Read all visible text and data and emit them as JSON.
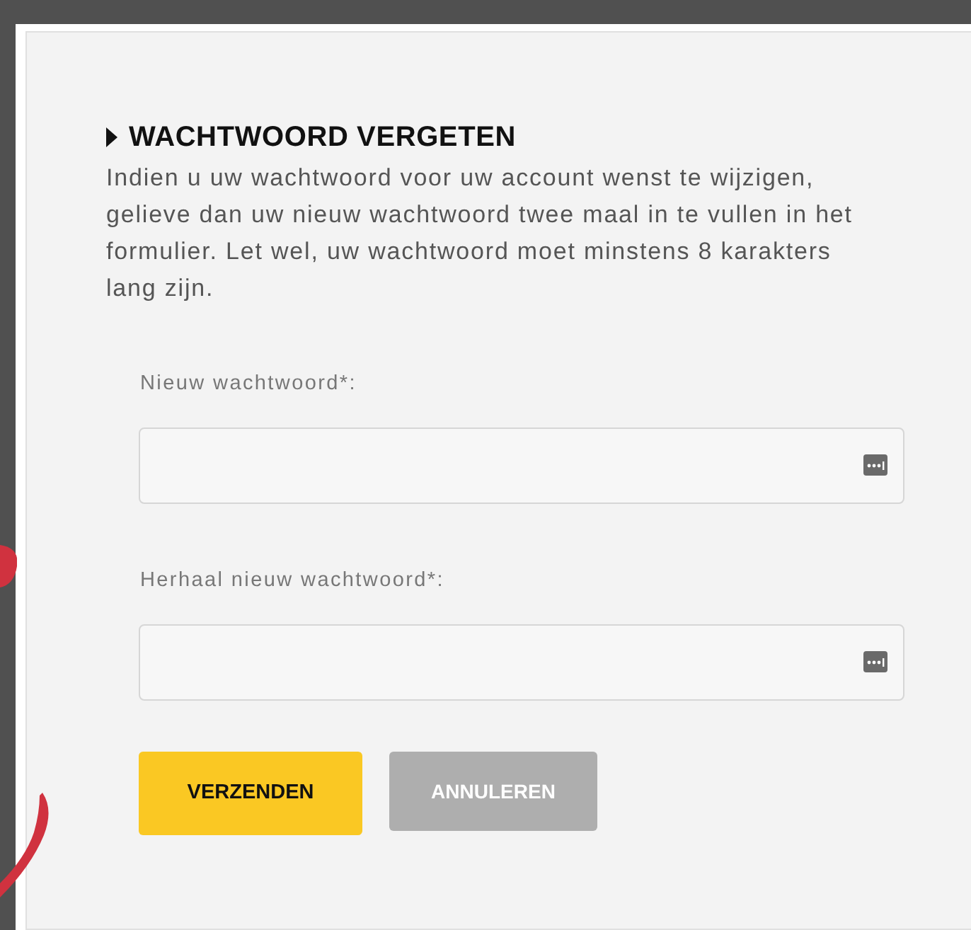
{
  "heading": "WACHTWOORD VERGETEN",
  "intro": "Indien u uw wachtwoord voor uw account wenst te wijzigen, gelieve dan uw nieuw wachtwoord twee maal in te vullen in het formulier. Let wel, uw wachtwoord moet minstens 8 karakters lang zijn.",
  "fields": [
    {
      "label": "Nieuw wachtwoord*:"
    },
    {
      "label": "Herhaal nieuw wachtwoord*:"
    }
  ],
  "buttons": [
    {
      "label": "VERZENDEN",
      "kind": "primary"
    },
    {
      "label": "ANNULEREN",
      "kind": "secondary"
    }
  ]
}
